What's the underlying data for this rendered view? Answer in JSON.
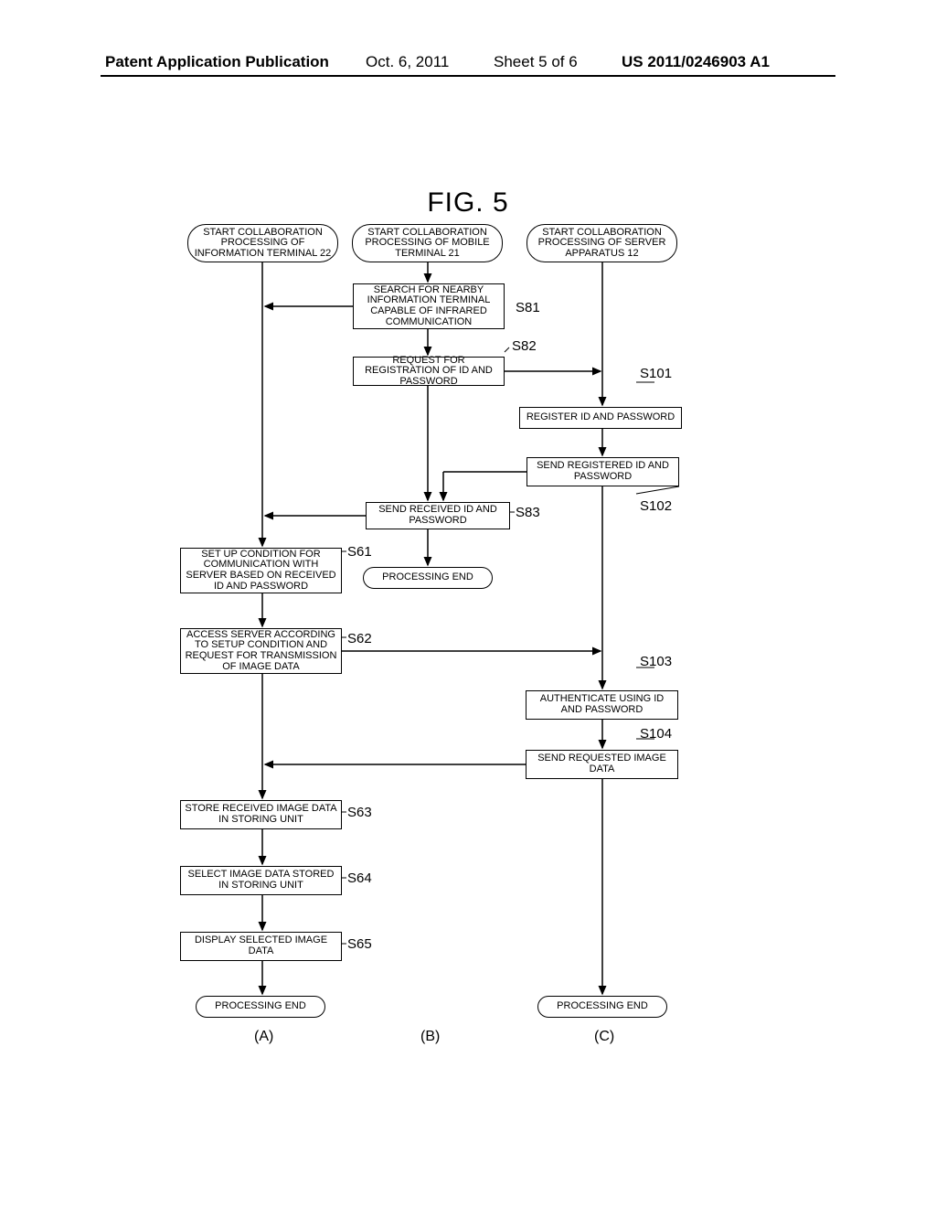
{
  "header": {
    "publication_label": "Patent Application Publication",
    "date": "Oct. 6, 2011",
    "sheet": "Sheet 5 of 6",
    "pub_number": "US 2011/0246903 A1"
  },
  "figure_title": "FIG. 5",
  "columns": {
    "a": "(A)",
    "b": "(B)",
    "c": "(C)"
  },
  "terminators": {
    "start_a": "START COLLABORATION PROCESSING OF INFORMATION TERMINAL 22",
    "start_b": "START COLLABORATION PROCESSING OF MOBILE TERMINAL 21",
    "start_c": "START COLLABORATION PROCESSING OF SERVER APPARATUS 12",
    "end_a": "PROCESSING END",
    "end_b": "PROCESSING END",
    "end_c": "PROCESSING END"
  },
  "steps": {
    "s81": "SEARCH FOR NEARBY INFORMATION TERMINAL CAPABLE OF INFRARED COMMUNICATION",
    "s82": "REQUEST FOR REGISTRATION OF ID AND PASSWORD",
    "s101": "REGISTER ID AND PASSWORD",
    "s102": "SEND REGISTERED ID AND PASSWORD",
    "s83": "SEND RECEIVED ID AND PASSWORD",
    "s61": "SET UP CONDITION FOR COMMUNICATION WITH SERVER BASED ON RECEIVED ID AND PASSWORD",
    "s62": "ACCESS SERVER ACCORDING TO SETUP CONDITION AND REQUEST FOR TRANSMISSION OF IMAGE DATA",
    "s103": "AUTHENTICATE USING ID AND PASSWORD",
    "s104": "SEND REQUESTED IMAGE DATA",
    "s63": "STORE RECEIVED IMAGE DATA IN STORING UNIT",
    "s64": "SELECT IMAGE DATA STORED IN STORING UNIT",
    "s65": "DISPLAY SELECTED IMAGE DATA"
  },
  "labels": {
    "s81": "S81",
    "s82": "S82",
    "s101": "S101",
    "s102": "S102",
    "s83": "S83",
    "s61": "S61",
    "s62": "S62",
    "s103": "S103",
    "s104": "S104",
    "s63": "S63",
    "s64": "S64",
    "s65": "S65"
  }
}
